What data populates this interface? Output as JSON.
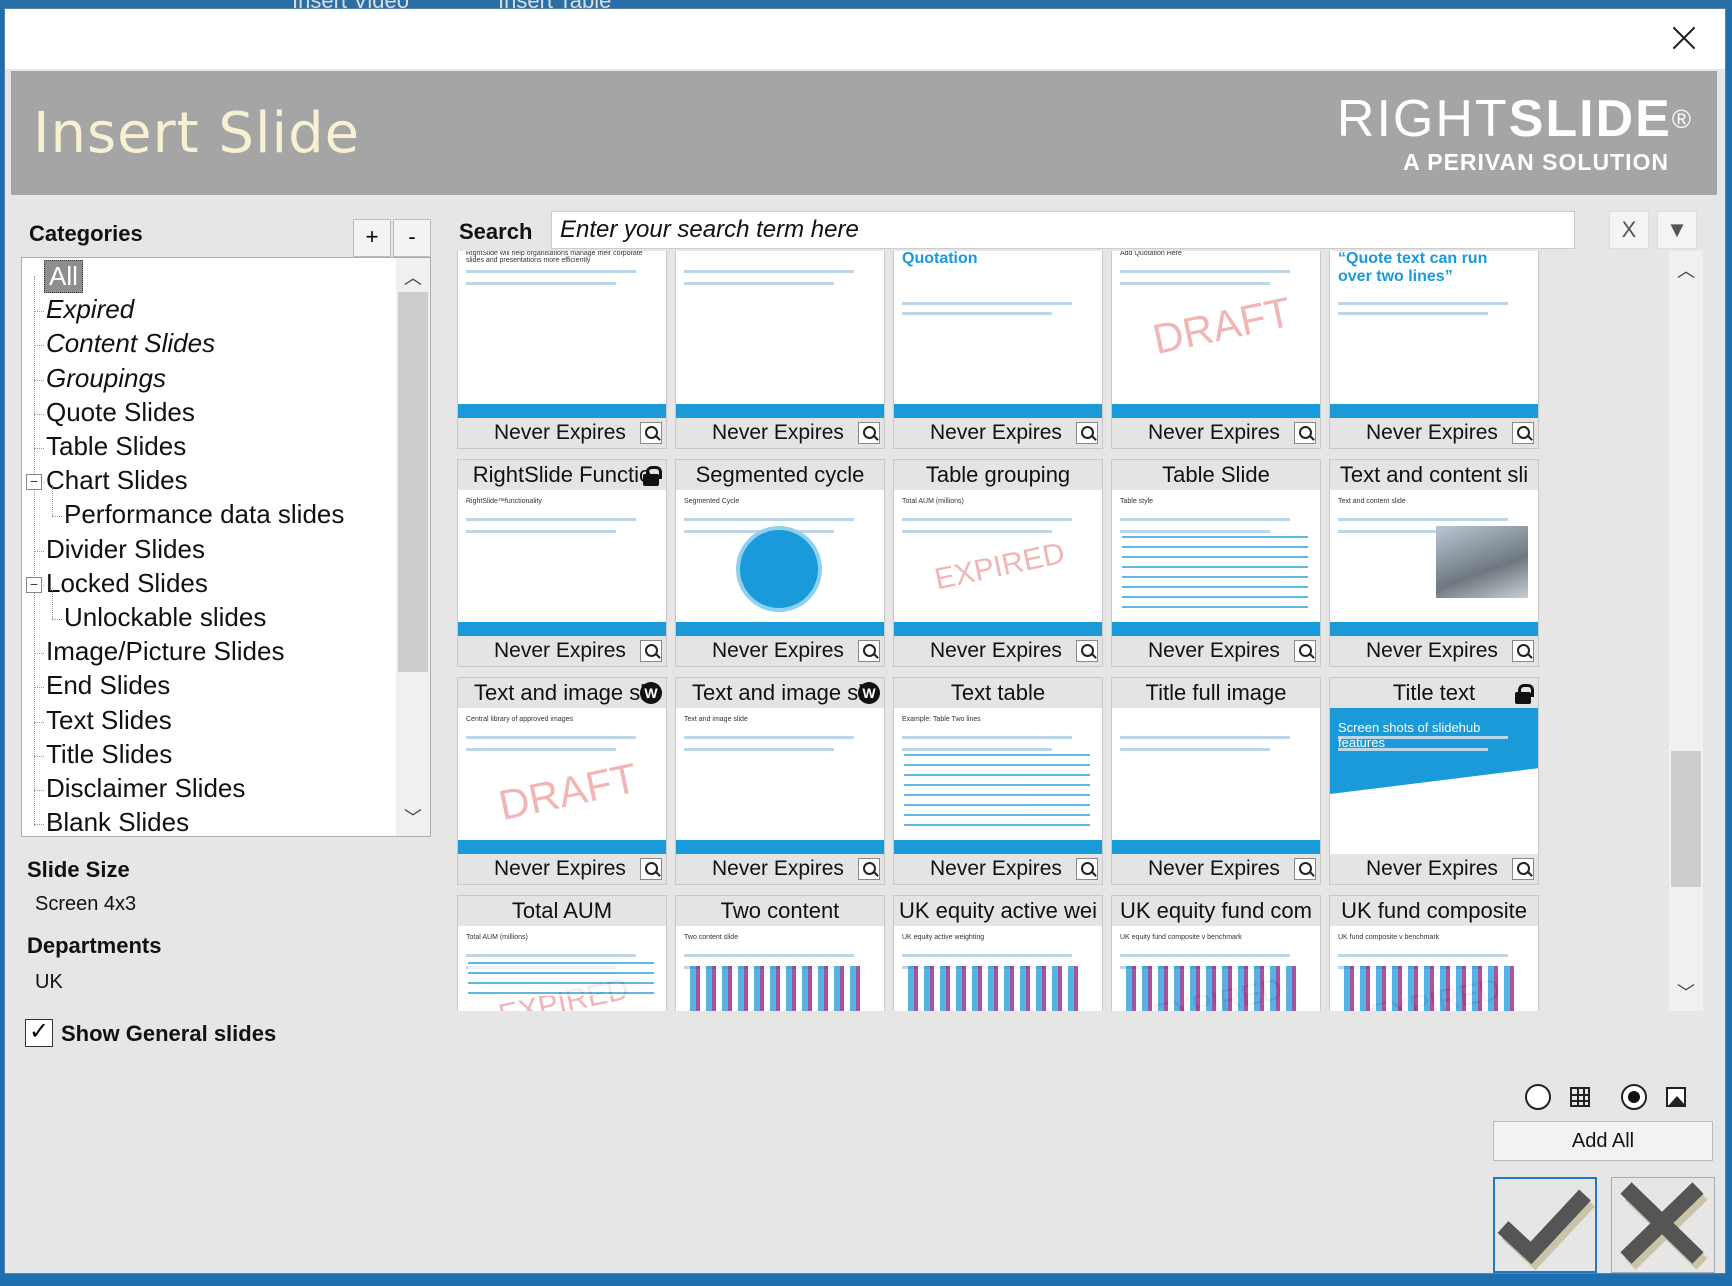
{
  "background": {
    "tab1": "Insert Video",
    "tab2": "Insert Table"
  },
  "header": {
    "title": "Insert Slide",
    "logo_main_light": "RIGHT",
    "logo_main_bold": "SLIDE",
    "logo_reg": "®",
    "logo_sub": "A PERIVAN SOLUTION"
  },
  "categories": {
    "heading": "Categories",
    "add_label": "+",
    "remove_label": "-",
    "items": [
      {
        "label": "All"
      },
      {
        "label": "Expired"
      },
      {
        "label": "Content Slides"
      },
      {
        "label": "Groupings"
      },
      {
        "label": "Quote Slides"
      },
      {
        "label": "Table Slides"
      },
      {
        "label": "Chart Slides"
      },
      {
        "label": "Performance data slides"
      },
      {
        "label": "Divider Slides"
      },
      {
        "label": "Locked Slides"
      },
      {
        "label": "Unlockable slides"
      },
      {
        "label": "Image/Picture Slides"
      },
      {
        "label": "End Slides"
      },
      {
        "label": "Text Slides"
      },
      {
        "label": "Title Slides"
      },
      {
        "label": "Disclaimer Slides"
      },
      {
        "label": "Blank Slides"
      }
    ],
    "expanders": [
      "−",
      "−"
    ]
  },
  "slide_size": {
    "label": "Slide Size",
    "value": "Screen 4x3"
  },
  "departments": {
    "label": "Departments",
    "value": "UK"
  },
  "show_general": {
    "label": "Show General slides",
    "checked": true,
    "mark": "✓"
  },
  "search": {
    "label": "Search",
    "placeholder": "Enter your search term here",
    "clear_label": "X",
    "toggle_label": "▼"
  },
  "expiry_text": "Never Expires",
  "watermark_draft": "DRAFT",
  "watermark_expired": "EXPIRED",
  "slides": [
    {
      "title": "",
      "expiry": "Never Expires",
      "snippet": "RightSlide will help organisations manage their corporate slides and presentations more efficiently"
    },
    {
      "title": "",
      "expiry": "Never Expires",
      "snippet": ""
    },
    {
      "title": "",
      "expiry": "Never Expires",
      "snippet": "Quotation"
    },
    {
      "title": "",
      "expiry": "Never Expires",
      "snippet": "Add Quotation Here"
    },
    {
      "title": "",
      "expiry": "Never Expires",
      "snippet": "“Quote text can run over two lines”"
    },
    {
      "title": "RightSlide Functio",
      "expiry": "Never Expires",
      "snippet": "RightSlide™functionality",
      "badge": "lock"
    },
    {
      "title": "Segmented cycle",
      "expiry": "Never Expires",
      "snippet": "Segmented Cycle"
    },
    {
      "title": "Table grouping",
      "expiry": "Never Expires",
      "snippet": "Total AUM (millions)"
    },
    {
      "title": "Table Slide",
      "expiry": "Never Expires",
      "snippet": "Table style"
    },
    {
      "title": "Text and content sli",
      "expiry": "Never Expires",
      "snippet": "Text and content slide"
    },
    {
      "title": "Text and image sli",
      "expiry": "Never Expires",
      "snippet": "Central library of approved images",
      "badge": "W"
    },
    {
      "title": "Text and image sli",
      "expiry": "Never Expires",
      "snippet": "Text and image slide",
      "badge": "W"
    },
    {
      "title": "Text table",
      "expiry": "Never Expires",
      "snippet": "Example: Table Two lines"
    },
    {
      "title": "Title full image",
      "expiry": "Never Expires",
      "snippet": ""
    },
    {
      "title": "Title text",
      "expiry": "Never Expires",
      "snippet": "Screen shots of slidehub features",
      "badge": "lock"
    },
    {
      "title": "Total AUM",
      "expiry": "",
      "snippet": "Total AUM (millions)"
    },
    {
      "title": "Two content",
      "expiry": "",
      "snippet": "Two content slide"
    },
    {
      "title": "UK equity active wei",
      "expiry": "",
      "snippet": "UK equity active weighting"
    },
    {
      "title": "UK equity fund com",
      "expiry": "",
      "snippet": "UK equity fund composite v benchmark"
    },
    {
      "title": "UK fund composite",
      "expiry": "",
      "snippet": "UK fund composite v benchmark"
    }
  ],
  "view_toggle": {
    "selected": "image"
  },
  "actions": {
    "add_all": "Add All"
  },
  "colors": {
    "accent": "#1a9ad8",
    "banner": "#a5a5a5",
    "title_text": "#f7f0d2"
  }
}
